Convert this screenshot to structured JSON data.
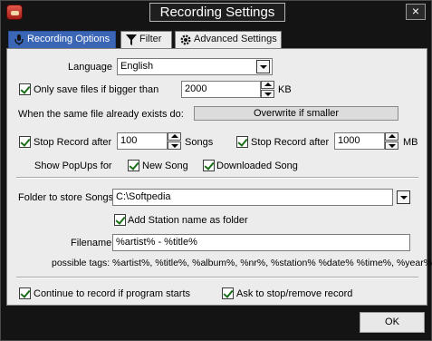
{
  "window": {
    "title": "Recording Settings",
    "close_glyph": "×"
  },
  "tabs": [
    {
      "label": "Recording Options",
      "icon": "microphone-icon",
      "active": true
    },
    {
      "label": "Filter",
      "icon": "funnel-icon",
      "active": false
    },
    {
      "label": "Advanced Settings",
      "icon": "gear-icon",
      "active": false
    }
  ],
  "language": {
    "label": "Language",
    "value": "English"
  },
  "only_save": {
    "label": "Only save files if bigger than",
    "checked": true,
    "value": "2000",
    "unit": "KB"
  },
  "same_file": {
    "label": "When the same file already exists do:",
    "value": "Overwrite if smaller"
  },
  "stop_songs": {
    "label": "Stop Record after",
    "checked": true,
    "value": "100",
    "unit": "Songs"
  },
  "stop_mb": {
    "label": "Stop Record after",
    "checked": true,
    "value": "1000",
    "unit": "MB"
  },
  "popups": {
    "label": "Show PopUps for",
    "new_song": {
      "label": "New Song",
      "checked": true
    },
    "downloaded_song": {
      "label": "Downloaded Song",
      "checked": true
    }
  },
  "folder": {
    "label": "Folder to store Songs",
    "value": "C:\\Softpedia"
  },
  "add_station": {
    "label": "Add Station name as folder",
    "checked": true
  },
  "filename": {
    "label": "Filename",
    "value": "%artist% - %title%"
  },
  "possible_tags": {
    "label": "possible tags:",
    "value": "%artist%, %title%, %album%, %nr%, %station% %date% %time%, %year%"
  },
  "continue_record": {
    "label": "Continue to record if program starts",
    "checked": true
  },
  "ask_stop": {
    "label": "Ask to stop/remove record",
    "checked": true
  },
  "ok_button": {
    "label": "OK"
  },
  "colors": {
    "tab_active": "#3b66b5",
    "panel_bg": "#ececec",
    "window_bg": "#141414"
  }
}
